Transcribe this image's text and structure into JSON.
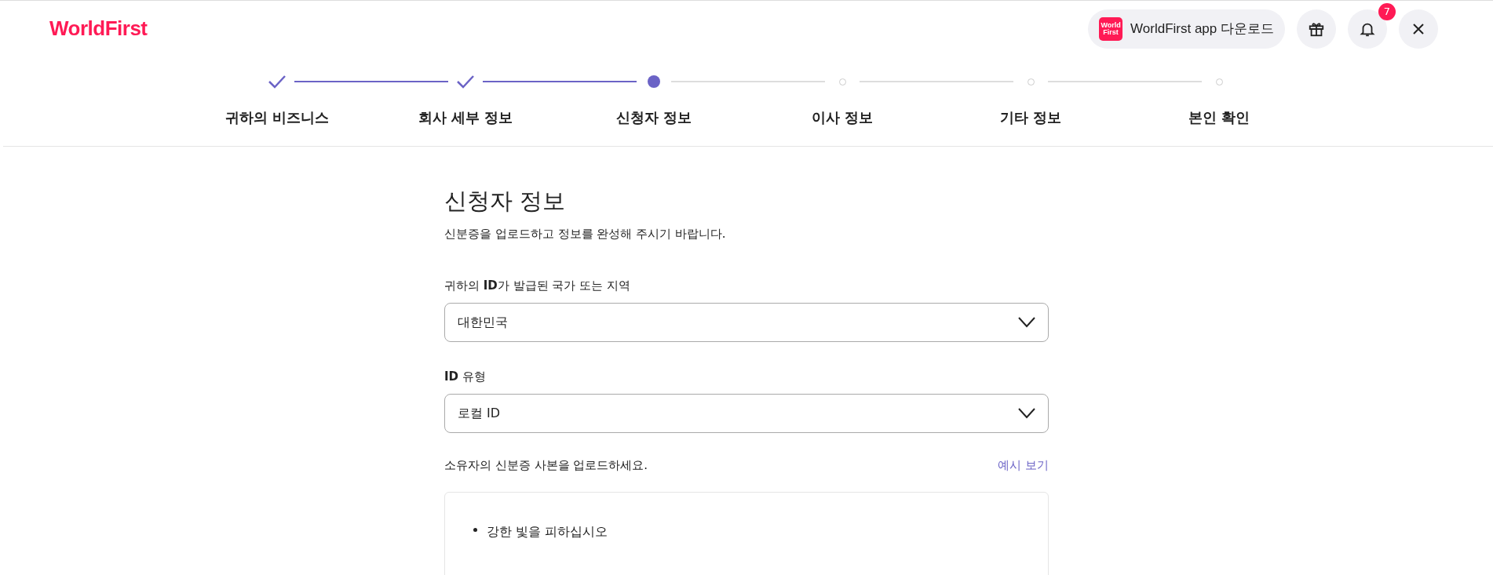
{
  "header": {
    "logo": "WorldFirst",
    "app_button": {
      "icon_lines": [
        "World",
        "First"
      ],
      "label": "WorldFirst app 다운로드"
    },
    "notifications": {
      "badge": "7"
    }
  },
  "steps": [
    {
      "label": "귀하의 비즈니스",
      "done": true,
      "current": false
    },
    {
      "label": "회사 세부 정보",
      "done": true,
      "current": false
    },
    {
      "label": "신청자 정보",
      "done": false,
      "current": true
    },
    {
      "label": "이사 정보",
      "done": false,
      "current": false
    },
    {
      "label": "기타 정보",
      "done": false,
      "current": false
    },
    {
      "label": "본인 확인",
      "done": false,
      "current": false
    }
  ],
  "form": {
    "title": "신청자 정보",
    "subtitle": "신분증을 업로드하고 정보를 완성해 주시기 바랍니다.",
    "fields": [
      {
        "label": "귀하의 **ID**가 발급된 국가 또는 지역",
        "value": "대한민국"
      },
      {
        "label": "**ID** 유형",
        "value": "로컬 ID"
      }
    ],
    "upload": {
      "label": "소유자의 신분증 사본을 업로드하세요.",
      "link": "예시 보기",
      "tips": [
        "강한 빛을 피하십시오"
      ]
    }
  }
}
